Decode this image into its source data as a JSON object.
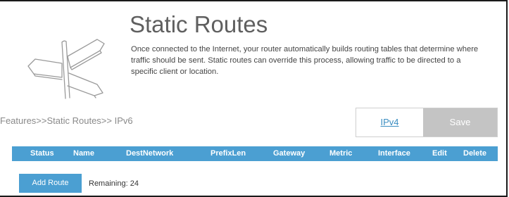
{
  "header": {
    "title": "Static Routes",
    "description": "Once connected to the Internet, your router automatically builds routing tables that determine where traffic should be sent. Static routes can override this process, allowing traffic to be directed to a specific client or location."
  },
  "breadcrumb": "Features>>Static Routes>> IPv6",
  "tabs": {
    "ipv4_label": "IPv4",
    "save_label": "Save"
  },
  "table": {
    "columns": [
      "Status",
      "Name",
      "DestNetwork",
      "PrefixLen",
      "Gateway",
      "Metric",
      "Interface",
      "Edit",
      "Delete"
    ]
  },
  "footer": {
    "add_route_label": "Add Route",
    "remaining_text": "Remaining: 24"
  },
  "colors": {
    "accent": "#4b9fd2",
    "save_disabled": "#c4c4c4",
    "link": "#3a8dc1"
  }
}
